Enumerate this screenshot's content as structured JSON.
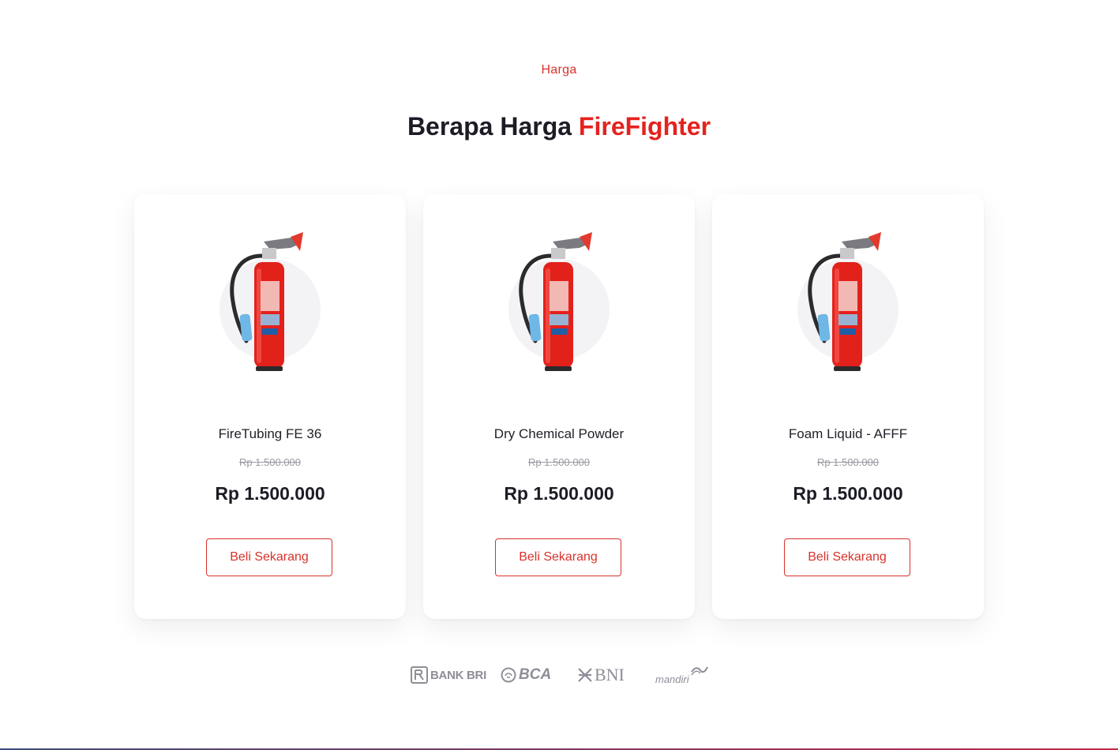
{
  "section": {
    "eyebrow": "Harga",
    "title_prefix": "Berapa Harga ",
    "title_accent": "FireFighter"
  },
  "products": [
    {
      "name": "FireTubing FE 36",
      "old_price": "Rp 1.500.000",
      "price": "Rp 1.500.000",
      "button_label": "Beli Sekarang",
      "image_icon": "fire-extinguisher-icon"
    },
    {
      "name": "Dry Chemical Powder",
      "old_price": "Rp 1.500.000",
      "price": "Rp 1.500.000",
      "button_label": "Beli Sekarang",
      "image_icon": "fire-extinguisher-icon"
    },
    {
      "name": "Foam Liquid - AFFF",
      "old_price": "Rp 1.500.000",
      "price": "Rp 1.500.000",
      "button_label": "Beli Sekarang",
      "image_icon": "fire-extinguisher-icon"
    }
  ],
  "banks": [
    {
      "name": "BANK BRI",
      "icon": "bri-logo-icon"
    },
    {
      "name": "BCA",
      "icon": "bca-logo-icon"
    },
    {
      "name": "BNI",
      "icon": "bni-logo-icon"
    },
    {
      "name": "mandiri",
      "icon": "mandiri-logo-icon"
    }
  ],
  "colors": {
    "accent": "#e4231f",
    "text_dark": "#1c1c26",
    "muted": "#9a9aa2",
    "bank_logo": "#8e8e98"
  }
}
